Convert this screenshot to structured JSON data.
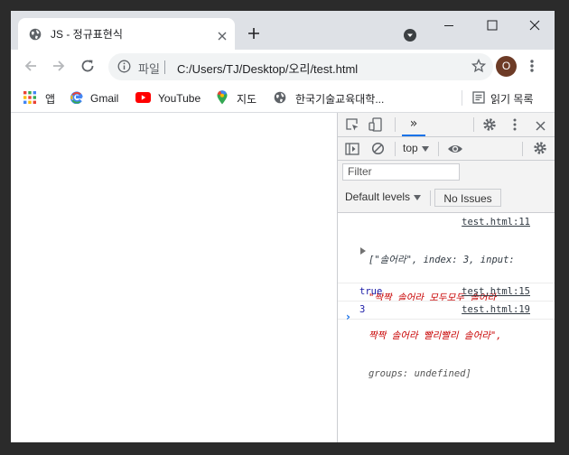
{
  "tab": {
    "title": "JS - 정규표현식",
    "favicon": "globe-icon"
  },
  "omnibox": {
    "label": "파일",
    "url": "C:/Users/TJ/Desktop/오리/test.html"
  },
  "profile": {
    "initial": "O",
    "color": "#6d3b26"
  },
  "bookmarks": {
    "items": [
      {
        "label": "앱",
        "icon": "apps-grid-icon"
      },
      {
        "label": "Gmail",
        "icon": "google-icon"
      },
      {
        "label": "YouTube",
        "icon": "youtube-icon"
      },
      {
        "label": "지도",
        "icon": "maps-pin-icon"
      },
      {
        "label": "한국기술교육대학...",
        "icon": "globe-icon"
      }
    ],
    "reading_list": "읽기 목록"
  },
  "devtools": {
    "tab_console": "»",
    "context": "top",
    "filter_placeholder": "Filter",
    "levels": "Default levels",
    "issues": "No Issues",
    "messages": [
      {
        "source": "test.html:11",
        "lines": [
          "[\"솔어라\", index: 3, input:",
          "\"짝짝 솔어라 모두모두 솔어라",
          "짝짝 솔어라 빨리빨리 솔어라\",",
          "groups: undefined]"
        ]
      },
      {
        "source": "test.html:15",
        "value": "true"
      },
      {
        "source": "test.html:19",
        "value": "3"
      }
    ],
    "prompt": "›"
  },
  "colors": {
    "accent": "#1a73e8",
    "string": "#c80000",
    "number": "#1a1aa6"
  }
}
